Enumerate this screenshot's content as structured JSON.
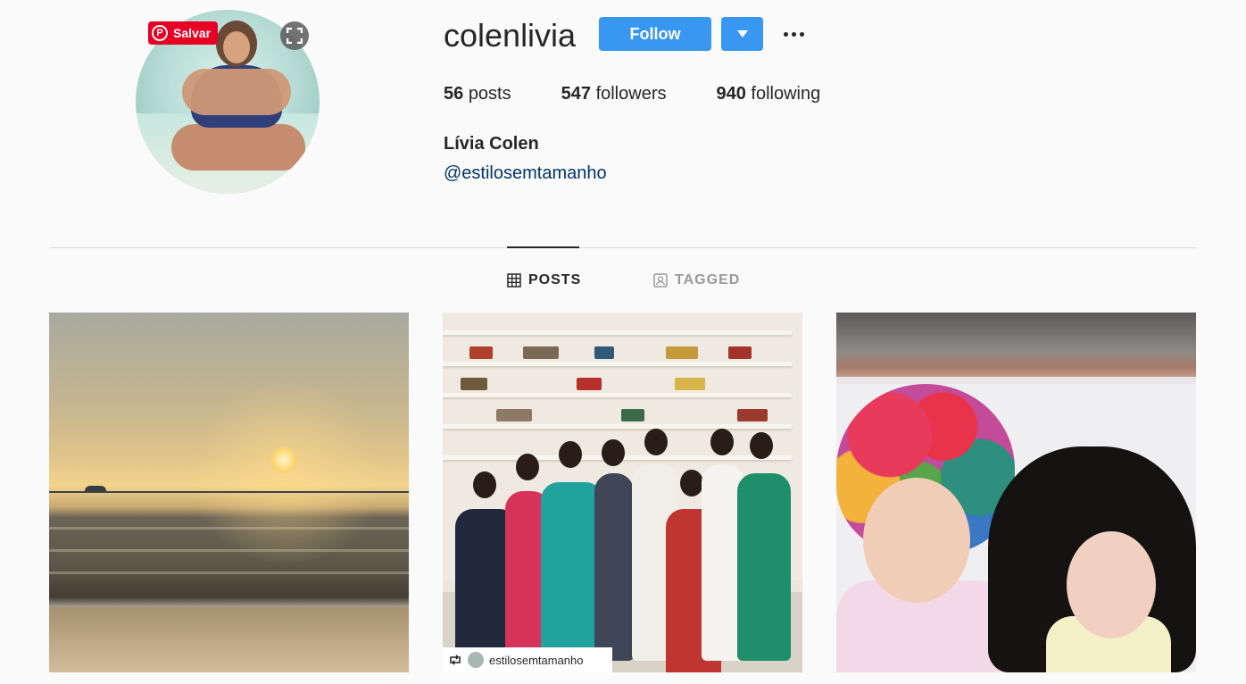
{
  "profile": {
    "username": "colenlivia",
    "full_name": "Lívia Colen",
    "bio_link": "@estilosemtamanho",
    "avatar_icon": "profile-photo"
  },
  "actions": {
    "follow_label": "Follow",
    "dropdown_icon": "caret-down-icon",
    "more_icon": "ellipsis-icon"
  },
  "pinterest": {
    "save_label": "Salvar",
    "pin_glyph": "P"
  },
  "stats": {
    "posts_count": "56",
    "posts_label": "posts",
    "followers_count": "547",
    "followers_label": "followers",
    "following_count": "940",
    "following_label": "following"
  },
  "tabs": [
    {
      "label": "POSTS",
      "active": true,
      "icon": "grid-icon"
    },
    {
      "label": "TAGGED",
      "active": false,
      "icon": "tagged-icon"
    }
  ],
  "posts": [
    {
      "alt_kind": "sunset-beach"
    },
    {
      "alt_kind": "group-photo",
      "credit": "estilosemtamanho",
      "credit_icon": "repost-icon"
    },
    {
      "alt_kind": "children-wigs"
    }
  ],
  "colors": {
    "accent": "#3897f0",
    "pinterest": "#e60023",
    "link": "#003569",
    "background": "#fafafa"
  }
}
